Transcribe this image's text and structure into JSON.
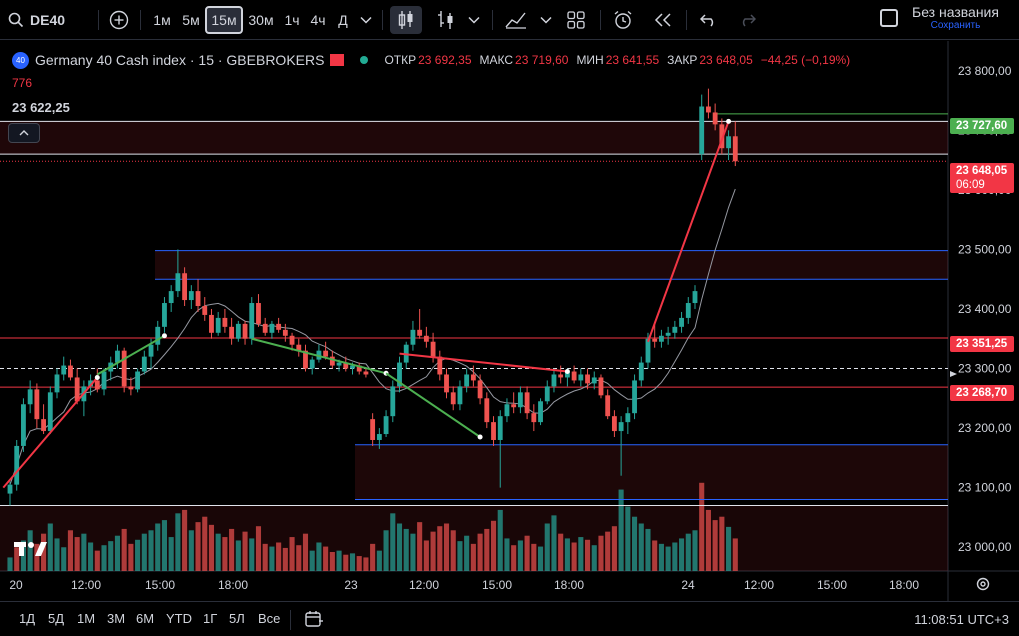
{
  "toolbar": {
    "symbol": "DE40",
    "intervals": [
      "1м",
      "5м",
      "15м",
      "30м",
      "1ч",
      "4ч",
      "Д"
    ],
    "active_interval": "15м",
    "layout_title": "Без названия",
    "save_label": "Сохранить"
  },
  "legend": {
    "badge": "40",
    "title": "Germany 40 Cash index · 15 · GBEBROKERS",
    "open_label": "ОТКР",
    "open": "23 692,35",
    "high_label": "МАКС",
    "high": "23 719,60",
    "low_label": "МИН",
    "low": "23 641,55",
    "close_label": "ЗАКР",
    "close": "23 648,05",
    "change": "−44,25 (−0,19%)",
    "volume": "776",
    "position_value": "23 622,25"
  },
  "price_tags": {
    "tag_high": "23 727,60",
    "last_price": "23 648,05",
    "countdown": "06:09",
    "tag_red1": "23 351,25",
    "tag_red2": "23 268,70"
  },
  "colors": {
    "up": "#26a69a",
    "down": "#ef5350",
    "vol_up": "#26a69a",
    "vol_down": "#ef5350",
    "blue_line": "#2962ff",
    "red_line": "#f23645",
    "green_line": "#4caf50"
  },
  "bottom": {
    "ranges": [
      "1Д",
      "5Д",
      "1М",
      "3М",
      "6М",
      "YTD",
      "1Г",
      "5Л",
      "Все"
    ],
    "clock": "11:08:51 UTC+3"
  },
  "chart_data": {
    "type": "candlestick",
    "y_axis_ticks": [
      {
        "value": 23800,
        "label": "23 800,00"
      },
      {
        "value": 23700,
        "label": "23 700,00"
      },
      {
        "value": 23600,
        "label": "23 600,00"
      },
      {
        "value": 23500,
        "label": "23 500,00"
      },
      {
        "value": 23400,
        "label": "23 400,00"
      },
      {
        "value": 23300,
        "label": "23 300,00"
      },
      {
        "value": 23200,
        "label": "23 200,00"
      },
      {
        "value": 23100,
        "label": "23 100,00"
      },
      {
        "value": 23000,
        "label": "23 000,00"
      }
    ],
    "x_axis_ticks": [
      "20",
      "12:00",
      "15:00",
      "18:00",
      "23",
      "12:00",
      "15:00",
      "18:00",
      "24",
      "12:00",
      "15:00",
      "18:00"
    ],
    "ylim": [
      22960,
      23850
    ],
    "horizontal_levels": [
      {
        "value": 23727.6,
        "color": "green"
      },
      {
        "value": 23715,
        "color": "white"
      },
      {
        "value": 23660,
        "color": "white"
      },
      {
        "value": 23648.05,
        "color": "red-dotted"
      },
      {
        "value": 23498,
        "color": "blue"
      },
      {
        "value": 23450,
        "color": "blue"
      },
      {
        "value": 23351.25,
        "color": "red"
      },
      {
        "value": 23300,
        "color": "white-dashed"
      },
      {
        "value": 23268.7,
        "color": "red"
      },
      {
        "value": 23172,
        "color": "blue"
      },
      {
        "value": 23080,
        "color": "blue"
      },
      {
        "value": 23070,
        "color": "white"
      }
    ],
    "candles": [
      [
        23090,
        23110,
        23070,
        23105
      ],
      [
        23105,
        23180,
        23095,
        23170
      ],
      [
        23170,
        23250,
        23160,
        23240
      ],
      [
        23240,
        23280,
        23225,
        23265
      ],
      [
        23265,
        23275,
        23200,
        23215
      ],
      [
        23215,
        23240,
        23190,
        23195
      ],
      [
        23195,
        23270,
        23190,
        23260
      ],
      [
        23260,
        23300,
        23250,
        23290
      ],
      [
        23290,
        23320,
        23280,
        23305
      ],
      [
        23305,
        23315,
        23280,
        23285
      ],
      [
        23285,
        23300,
        23240,
        23245
      ],
      [
        23245,
        23280,
        23220,
        23270
      ],
      [
        23270,
        23290,
        23255,
        23280
      ],
      [
        23280,
        23300,
        23260,
        23265
      ],
      [
        23265,
        23300,
        23255,
        23295
      ],
      [
        23295,
        23320,
        23280,
        23310
      ],
      [
        23310,
        23340,
        23300,
        23330
      ],
      [
        23330,
        23335,
        23260,
        23270
      ],
      [
        23270,
        23285,
        23255,
        23265
      ],
      [
        23265,
        23300,
        23260,
        23295
      ],
      [
        23295,
        23330,
        23290,
        23320
      ],
      [
        23320,
        23350,
        23300,
        23340
      ],
      [
        23340,
        23380,
        23330,
        23370
      ],
      [
        23370,
        23420,
        23360,
        23410
      ],
      [
        23410,
        23440,
        23395,
        23430
      ],
      [
        23430,
        23500,
        23420,
        23460
      ],
      [
        23460,
        23470,
        23405,
        23415
      ],
      [
        23415,
        23440,
        23400,
        23430
      ],
      [
        23430,
        23450,
        23395,
        23405
      ],
      [
        23405,
        23420,
        23380,
        23390
      ],
      [
        23390,
        23400,
        23350,
        23360
      ],
      [
        23360,
        23395,
        23355,
        23385
      ],
      [
        23385,
        23400,
        23360,
        23370
      ],
      [
        23370,
        23385,
        23340,
        23350
      ],
      [
        23350,
        23380,
        23345,
        23375
      ],
      [
        23375,
        23380,
        23340,
        23350
      ],
      [
        23350,
        23420,
        23340,
        23410
      ],
      [
        23410,
        23425,
        23370,
        23375
      ],
      [
        23375,
        23385,
        23355,
        23360
      ],
      [
        23360,
        23380,
        23350,
        23375
      ],
      [
        23375,
        23385,
        23360,
        23365
      ],
      [
        23365,
        23375,
        23345,
        23355
      ],
      [
        23355,
        23360,
        23330,
        23340
      ],
      [
        23340,
        23350,
        23320,
        23330
      ],
      [
        23330,
        23340,
        23295,
        23300
      ],
      [
        23300,
        23320,
        23290,
        23315
      ],
      [
        23315,
        23340,
        23310,
        23330
      ],
      [
        23330,
        23345,
        23315,
        23320
      ],
      [
        23320,
        23330,
        23300,
        23305
      ],
      [
        23305,
        23315,
        23295,
        23310
      ],
      [
        23310,
        23320,
        23295,
        23300
      ],
      [
        23300,
        23310,
        23290,
        23305
      ],
      [
        23305,
        23310,
        23290,
        23295
      ],
      [
        23295,
        23300,
        23285,
        23290
      ],
      [
        23215,
        23225,
        23170,
        23180
      ],
      [
        23180,
        23200,
        23165,
        23190
      ],
      [
        23190,
        23230,
        23185,
        23220
      ],
      [
        23220,
        23280,
        23210,
        23270
      ],
      [
        23270,
        23320,
        23260,
        23310
      ],
      [
        23310,
        23345,
        23300,
        23340
      ],
      [
        23340,
        23380,
        23330,
        23365
      ],
      [
        23365,
        23400,
        23350,
        23355
      ],
      [
        23355,
        23370,
        23335,
        23345
      ],
      [
        23345,
        23360,
        23310,
        23320
      ],
      [
        23320,
        23330,
        23280,
        23290
      ],
      [
        23290,
        23300,
        23250,
        23260
      ],
      [
        23260,
        23270,
        23230,
        23240
      ],
      [
        23240,
        23280,
        23230,
        23270
      ],
      [
        23270,
        23300,
        23260,
        23290
      ],
      [
        23290,
        23305,
        23270,
        23280
      ],
      [
        23280,
        23290,
        23240,
        23250
      ],
      [
        23250,
        23260,
        23200,
        23210
      ],
      [
        23210,
        23220,
        23170,
        23180
      ],
      [
        23180,
        23230,
        23100,
        23220
      ],
      [
        23220,
        23250,
        23210,
        23240
      ],
      [
        23240,
        23260,
        23225,
        23235
      ],
      [
        23235,
        23270,
        23225,
        23260
      ],
      [
        23260,
        23270,
        23215,
        23225
      ],
      [
        23225,
        23240,
        23195,
        23210
      ],
      [
        23210,
        23250,
        23205,
        23245
      ],
      [
        23245,
        23280,
        23240,
        23270
      ],
      [
        23270,
        23300,
        23260,
        23290
      ],
      [
        23290,
        23305,
        23275,
        23285
      ],
      [
        23285,
        23300,
        23270,
        23295
      ],
      [
        23295,
        23305,
        23275,
        23280
      ],
      [
        23280,
        23300,
        23270,
        23290
      ],
      [
        23290,
        23300,
        23265,
        23275
      ],
      [
        23275,
        23295,
        23265,
        23285
      ],
      [
        23285,
        23290,
        23250,
        23255
      ],
      [
        23255,
        23265,
        23215,
        23220
      ],
      [
        23220,
        23230,
        23185,
        23195
      ],
      [
        23195,
        23220,
        23120,
        23210
      ],
      [
        23210,
        23235,
        23190,
        23225
      ],
      [
        23225,
        23290,
        23215,
        23280
      ],
      [
        23280,
        23320,
        23270,
        23310
      ],
      [
        23310,
        23360,
        23300,
        23350
      ],
      [
        23350,
        23375,
        23335,
        23345
      ],
      [
        23345,
        23365,
        23335,
        23355
      ],
      [
        23355,
        23370,
        23340,
        23360
      ],
      [
        23360,
        23380,
        23350,
        23370
      ],
      [
        23370,
        23395,
        23360,
        23385
      ],
      [
        23385,
        23420,
        23375,
        23410
      ],
      [
        23410,
        23440,
        23400,
        23430
      ],
      [
        23660,
        23760,
        23650,
        23740
      ],
      [
        23740,
        23770,
        23720,
        23730
      ],
      [
        23730,
        23745,
        23700,
        23710
      ],
      [
        23710,
        23720,
        23660,
        23670
      ],
      [
        23670,
        23700,
        23650,
        23690
      ],
      [
        23690,
        23715,
        23640,
        23648
      ]
    ],
    "volume": [
      [
        20,
        "u"
      ],
      [
        35,
        "d"
      ],
      [
        45,
        "u"
      ],
      [
        60,
        "u"
      ],
      [
        40,
        "d"
      ],
      [
        55,
        "d"
      ],
      [
        70,
        "u"
      ],
      [
        48,
        "u"
      ],
      [
        35,
        "u"
      ],
      [
        60,
        "d"
      ],
      [
        50,
        "d"
      ],
      [
        55,
        "u"
      ],
      [
        42,
        "u"
      ],
      [
        30,
        "d"
      ],
      [
        38,
        "u"
      ],
      [
        44,
        "u"
      ],
      [
        52,
        "u"
      ],
      [
        62,
        "d"
      ],
      [
        40,
        "d"
      ],
      [
        46,
        "u"
      ],
      [
        55,
        "u"
      ],
      [
        60,
        "u"
      ],
      [
        70,
        "u"
      ],
      [
        75,
        "u"
      ],
      [
        50,
        "u"
      ],
      [
        85,
        "u"
      ],
      [
        90,
        "d"
      ],
      [
        60,
        "u"
      ],
      [
        72,
        "d"
      ],
      [
        80,
        "d"
      ],
      [
        68,
        "d"
      ],
      [
        55,
        "u"
      ],
      [
        50,
        "d"
      ],
      [
        62,
        "d"
      ],
      [
        45,
        "u"
      ],
      [
        58,
        "d"
      ],
      [
        48,
        "u"
      ],
      [
        66,
        "d"
      ],
      [
        40,
        "d"
      ],
      [
        36,
        "u"
      ],
      [
        42,
        "d"
      ],
      [
        34,
        "d"
      ],
      [
        50,
        "d"
      ],
      [
        38,
        "d"
      ],
      [
        55,
        "d"
      ],
      [
        30,
        "u"
      ],
      [
        42,
        "u"
      ],
      [
        36,
        "d"
      ],
      [
        28,
        "d"
      ],
      [
        30,
        "u"
      ],
      [
        24,
        "d"
      ],
      [
        26,
        "u"
      ],
      [
        22,
        "d"
      ],
      [
        20,
        "d"
      ],
      [
        40,
        "d"
      ],
      [
        30,
        "u"
      ],
      [
        60,
        "u"
      ],
      [
        85,
        "u"
      ],
      [
        70,
        "u"
      ],
      [
        62,
        "u"
      ],
      [
        55,
        "u"
      ],
      [
        72,
        "d"
      ],
      [
        45,
        "d"
      ],
      [
        58,
        "d"
      ],
      [
        66,
        "d"
      ],
      [
        70,
        "d"
      ],
      [
        60,
        "d"
      ],
      [
        44,
        "u"
      ],
      [
        52,
        "u"
      ],
      [
        40,
        "d"
      ],
      [
        55,
        "d"
      ],
      [
        62,
        "d"
      ],
      [
        74,
        "d"
      ],
      [
        90,
        "u"
      ],
      [
        48,
        "u"
      ],
      [
        38,
        "d"
      ],
      [
        45,
        "u"
      ],
      [
        52,
        "d"
      ],
      [
        40,
        "d"
      ],
      [
        36,
        "u"
      ],
      [
        70,
        "u"
      ],
      [
        82,
        "u"
      ],
      [
        55,
        "d"
      ],
      [
        48,
        "u"
      ],
      [
        42,
        "d"
      ],
      [
        50,
        "u"
      ],
      [
        46,
        "d"
      ],
      [
        38,
        "u"
      ],
      [
        52,
        "d"
      ],
      [
        58,
        "d"
      ],
      [
        66,
        "d"
      ],
      [
        120,
        "u"
      ],
      [
        95,
        "u"
      ],
      [
        80,
        "u"
      ],
      [
        70,
        "u"
      ],
      [
        62,
        "u"
      ],
      [
        45,
        "d"
      ],
      [
        40,
        "u"
      ],
      [
        36,
        "u"
      ],
      [
        42,
        "u"
      ],
      [
        48,
        "u"
      ],
      [
        55,
        "u"
      ],
      [
        60,
        "u"
      ],
      [
        130,
        "d"
      ],
      [
        90,
        "d"
      ],
      [
        75,
        "d"
      ],
      [
        80,
        "d"
      ],
      [
        65,
        "u"
      ],
      [
        48,
        "d"
      ]
    ]
  }
}
